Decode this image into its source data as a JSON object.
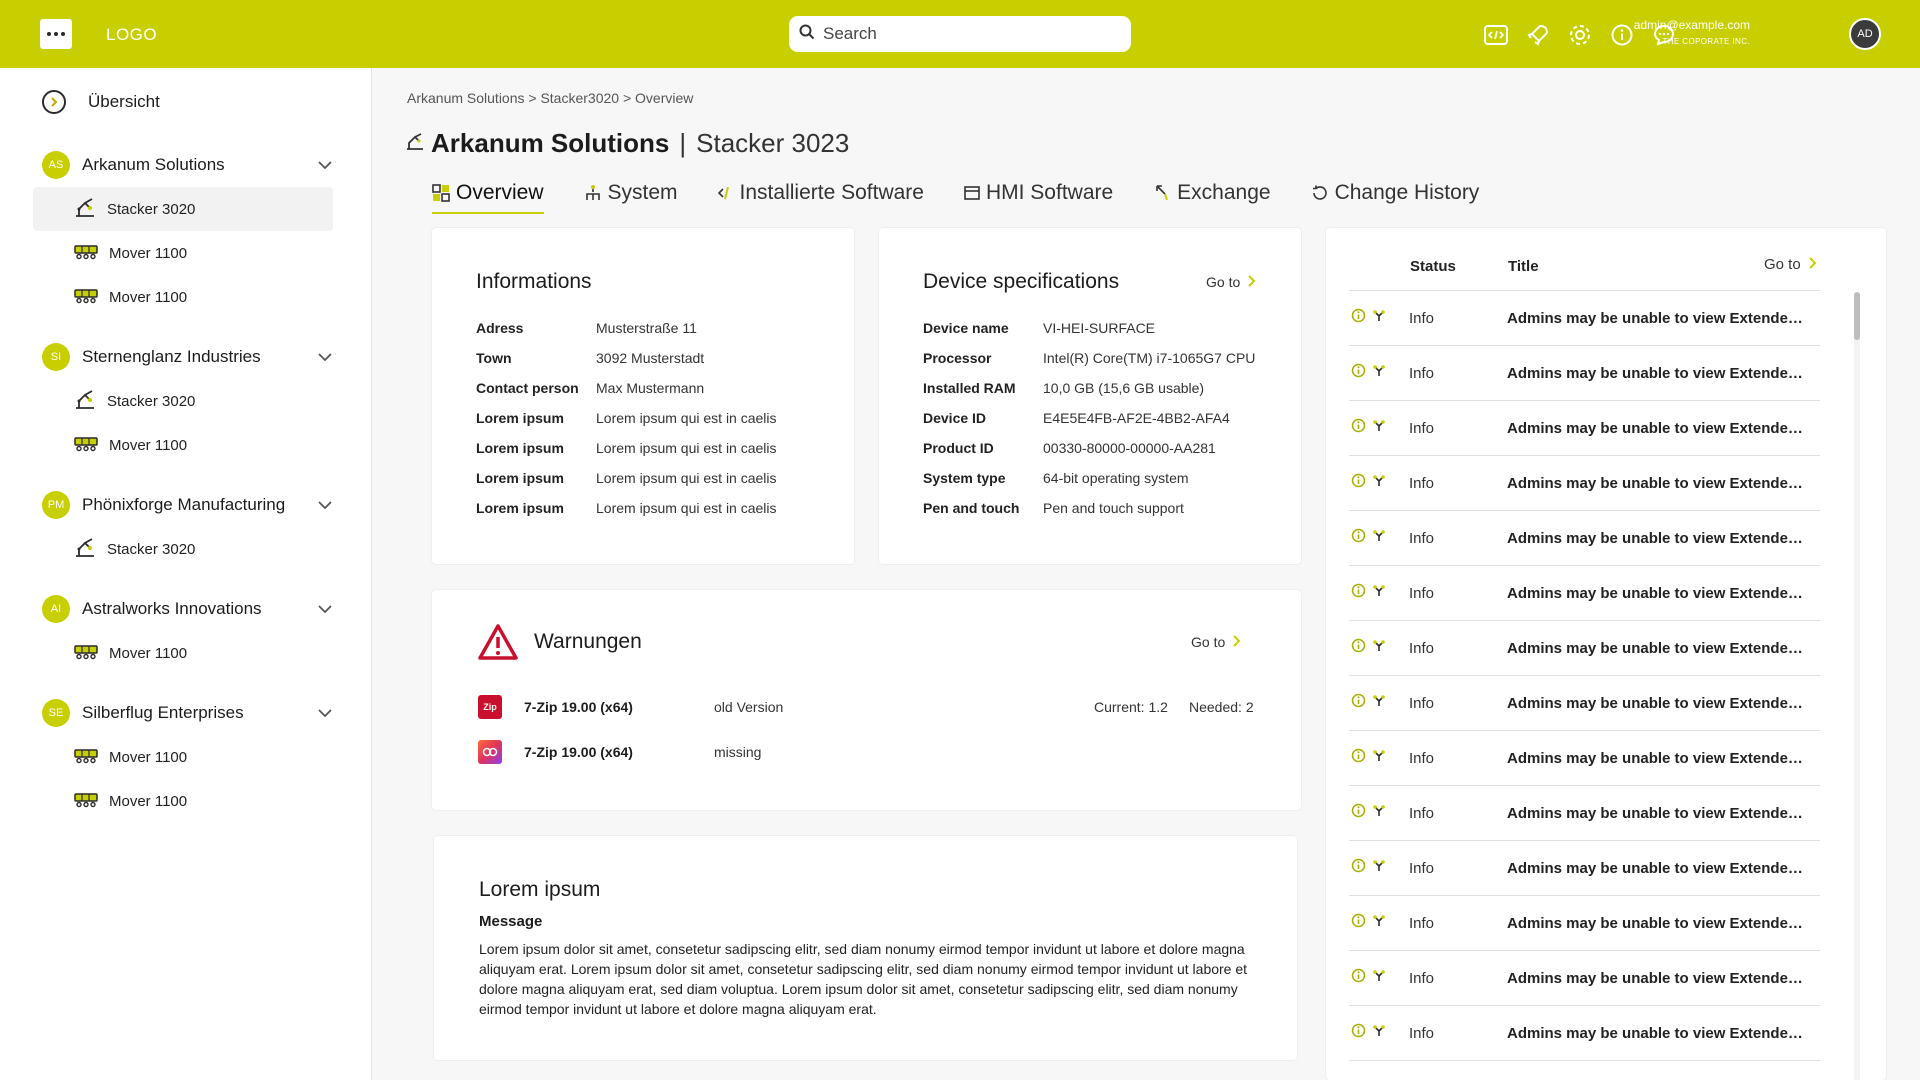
{
  "topbar": {
    "logo": "LOGO",
    "search_placeholder": "Search",
    "icons": [
      "code-icon",
      "rocket-icon",
      "gear-icon",
      "info-icon",
      "chat-icon"
    ],
    "user_email": "admin@example.com",
    "user_company": "THE COPORATE INC.",
    "user_initials": "AD"
  },
  "sidebar": {
    "overview_label": "Übersicht",
    "groups": [
      {
        "initials": "AS",
        "name": "Arkanum Solutions",
        "items": [
          "Stacker 3020",
          "Mover 1100",
          "Mover 1100"
        ]
      },
      {
        "initials": "SI",
        "name": "Sternenglanz Industries",
        "items": [
          "Stacker 3020",
          "Mover 1100"
        ]
      },
      {
        "initials": "PM",
        "name": "Phönixforge Manufacturing",
        "items": [
          "Stacker 3020"
        ]
      },
      {
        "initials": "AI",
        "name": "Astralworks Innovations",
        "items": [
          "Mover 1100"
        ]
      },
      {
        "initials": "SE",
        "name": "Silberflug Enterprises",
        "items": [
          "Mover 1100",
          "Mover 1100"
        ]
      }
    ]
  },
  "breadcrumb": "Arkanum Solutions > Stacker3020 > Overview",
  "title": {
    "company": "Arkanum Solutions",
    "separator": "|",
    "device": "Stacker 3023"
  },
  "tabs": [
    "Overview",
    "System",
    "Installierte Software",
    "HMI Software",
    "Exchange",
    "Change History"
  ],
  "informations": {
    "title": "Informations",
    "rows": [
      {
        "k": "Adress",
        "v": "Musterstraße 11"
      },
      {
        "k": "Town",
        "v": "3092 Musterstadt"
      },
      {
        "k": "Contact person",
        "v": "Max Mustermann"
      },
      {
        "k": "Lorem ipsum",
        "v": "Lorem ipsum qui est in caelis"
      },
      {
        "k": "Lorem ipsum",
        "v": "Lorem ipsum qui est in caelis"
      },
      {
        "k": "Lorem ipsum",
        "v": "Lorem ipsum qui est in caelis"
      },
      {
        "k": "Lorem ipsum",
        "v": "Lorem ipsum qui est in caelis"
      }
    ]
  },
  "device_specs": {
    "title": "Device specifications",
    "goto": "Go to",
    "rows": [
      {
        "k": "Device name",
        "v": "VI-HEI-SURFACE"
      },
      {
        "k": "Processor",
        "v": "Intel(R) Core(TM) i7-1065G7 CPU"
      },
      {
        "k": "Installed RAM",
        "v": "10,0 GB (15,6 GB usable)"
      },
      {
        "k": "Device ID",
        "v": "E4E5E4FB-AF2E-4BB2-AFA4"
      },
      {
        "k": "Product ID",
        "v": "00330-80000-00000-AA281"
      },
      {
        "k": "System type",
        "v": "64-bit operating system"
      },
      {
        "k": "Pen and touch",
        "v": "Pen and touch support"
      }
    ]
  },
  "warnings": {
    "title": "Warnungen",
    "goto": "Go to",
    "rows": [
      {
        "icon_text": "Zip",
        "name": "7-Zip 19.00 (x64)",
        "status": "old Version",
        "current": "Current: 1.2",
        "needed": "Needed: 2",
        "color": "#c8102e"
      },
      {
        "icon_text": "",
        "name": "7-Zip 19.00 (x64)",
        "status": "missing",
        "current": "",
        "needed": "",
        "color": "#e0335a"
      }
    ]
  },
  "message_card": {
    "title": "Lorem ipsum",
    "label": "Message",
    "body": "Lorem ipsum dolor sit amet, consetetur sadipscing elitr, sed diam nonumy eirmod tempor invidunt ut labore et dolore magna aliquyam erat. Lorem ipsum dolor sit amet, consetetur sadipscing elitr, sed diam nonumy eirmod tempor invidunt ut labore et dolore magna aliquyam erat, sed diam voluptua. Lorem ipsum dolor sit amet, consetetur sadipscing elitr, sed diam nonumy eirmod tempor invidunt ut labore et dolore magna aliquyam erat."
  },
  "history": {
    "col_status": "Status",
    "col_title": "Title",
    "goto": "Go to",
    "rows": [
      {
        "status": "Info",
        "title": "Admins may be unable to view Extended..."
      },
      {
        "status": "Info",
        "title": "Admins may be unable to view Extended..."
      },
      {
        "status": "Info",
        "title": "Admins may be unable to view Extended..."
      },
      {
        "status": "Info",
        "title": "Admins may be unable to view Extended..."
      },
      {
        "status": "Info",
        "title": "Admins may be unable to view Extended..."
      },
      {
        "status": "Info",
        "title": "Admins may be unable to view Extended..."
      },
      {
        "status": "Info",
        "title": "Admins may be unable to view Extended..."
      },
      {
        "status": "Info",
        "title": "Admins may be unable to view Extended..."
      },
      {
        "status": "Info",
        "title": "Admins may be unable to view Extended..."
      },
      {
        "status": "Info",
        "title": "Admins may be unable to view Extended..."
      },
      {
        "status": "Info",
        "title": "Admins may be unable to view Extended..."
      },
      {
        "status": "Info",
        "title": "Admins may be unable to view Extended..."
      },
      {
        "status": "Info",
        "title": "Admins may be unable to view Extended..."
      },
      {
        "status": "Info",
        "title": "Admins may be unable to view Extended..."
      }
    ]
  },
  "colors": {
    "accent": "#c8cf00",
    "warning_red": "#c8102e"
  }
}
